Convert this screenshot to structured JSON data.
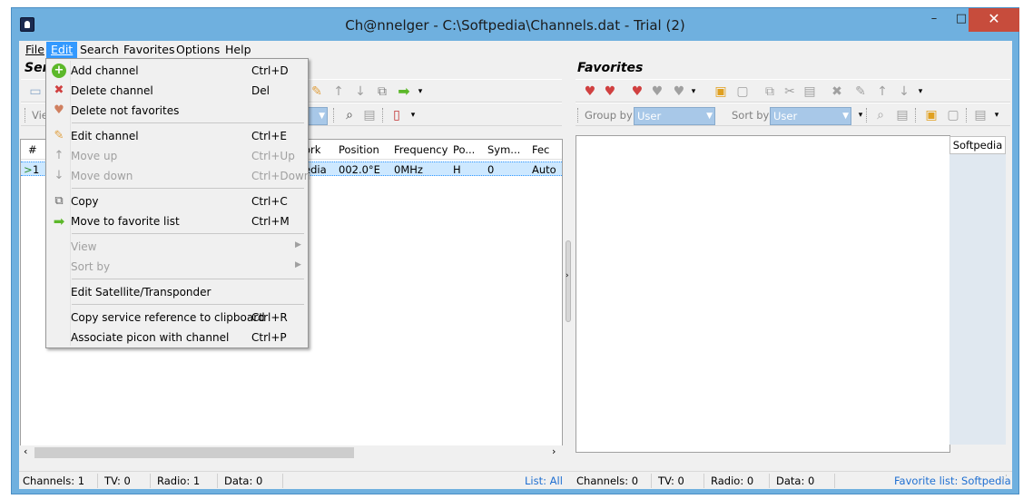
{
  "window": {
    "title": "Ch@nnelger - C:\\Softpedia\\Channels.dat - Trial (2)",
    "minimize": "–",
    "maximize": "□",
    "close": "✕"
  },
  "menubar": {
    "items": [
      "File",
      "Edit",
      "Search",
      "Favorites",
      "Options",
      "Help"
    ]
  },
  "left_panel": {
    "title": "Ser",
    "view_label": "Vie",
    "columns": [
      "#",
      "ork",
      "Position",
      "Frequency",
      "Po...",
      "Sym...",
      "Fec"
    ],
    "rows": [
      {
        "num": "1",
        "network": "edia",
        "position": "002.0°E",
        "frequency": "0MHz",
        "pol": "H",
        "sym": "0",
        "fec": "Auto"
      }
    ],
    "status": {
      "channels": "Channels: 1",
      "tv": "TV: 0",
      "radio": "Radio: 1",
      "data": "Data: 0",
      "list": "List: All"
    }
  },
  "right_panel": {
    "title": "Favorites",
    "group_by_label": "Group by",
    "group_by_value": "User",
    "sort_by_label": "Sort by",
    "sort_by_value": "User",
    "tab_label": "Softpedia",
    "status": {
      "channels": "Channels: 0",
      "tv": "TV: 0",
      "radio": "Radio: 0",
      "data": "Data: 0",
      "list": "Favorite list: Softpedia"
    }
  },
  "edit_menu": {
    "items": [
      {
        "label": "Add channel",
        "shortcut": "Ctrl+D",
        "icon": "add-icon",
        "disabled": false
      },
      {
        "label": "Delete channel",
        "shortcut": "Del",
        "icon": "delete-icon",
        "disabled": false
      },
      {
        "label": "Delete not favorites",
        "shortcut": "",
        "icon": "heart-delete-icon",
        "disabled": false
      },
      {
        "label": "Edit channel",
        "shortcut": "Ctrl+E",
        "icon": "pencil-icon",
        "disabled": false
      },
      {
        "label": "Move up",
        "shortcut": "Ctrl+Up",
        "icon": "arrow-up-icon",
        "disabled": true
      },
      {
        "label": "Move down",
        "shortcut": "Ctrl+Down",
        "icon": "arrow-down-icon",
        "disabled": true
      },
      {
        "label": "Copy",
        "shortcut": "Ctrl+C",
        "icon": "copy-icon",
        "disabled": false
      },
      {
        "label": "Move to favorite list",
        "shortcut": "Ctrl+M",
        "icon": "arrow-right-icon",
        "disabled": false
      },
      {
        "label": "View",
        "shortcut": "",
        "icon": "",
        "disabled": true
      },
      {
        "label": "Sort by",
        "shortcut": "",
        "icon": "",
        "disabled": true
      },
      {
        "label": "Edit Satellite/Transponder",
        "shortcut": "",
        "icon": "",
        "disabled": false
      },
      {
        "label": "Copy service reference to clipboard",
        "shortcut": "Ctrl+R",
        "icon": "",
        "disabled": false
      },
      {
        "label": "Associate picon with channel",
        "shortcut": "Ctrl+P",
        "icon": "",
        "disabled": false
      }
    ]
  },
  "colors": {
    "accent": "#3399ff",
    "window_frame": "#6fb0df",
    "close_button": "#c74c3c",
    "selected_row": "#cde8ff",
    "link": "#1f6fd1"
  }
}
